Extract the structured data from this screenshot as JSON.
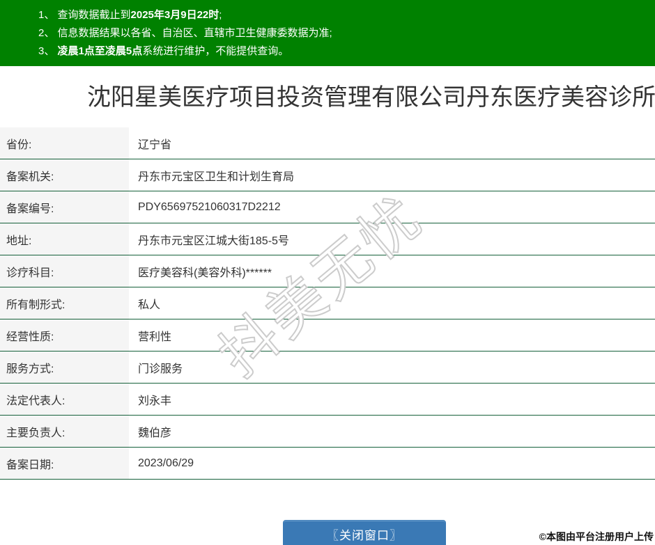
{
  "notice": {
    "items": [
      {
        "pre": "1、 查询数据截止到",
        "bold": "2025年3月9日22时",
        "post": ";"
      },
      {
        "pre": "2、 信息数据结果以各省、自治区、直辖市卫生健康委数据为准;",
        "bold": "",
        "post": ""
      },
      {
        "pre": "3、 ",
        "bold": "凌晨1点至凌晨5点",
        "post": "系统进行维护，不能提供查询。"
      }
    ]
  },
  "title": "沈阳星美医疗项目投资管理有限公司丹东医疗美容诊所",
  "table": {
    "rows": [
      {
        "label": "省份:",
        "value": "辽宁省"
      },
      {
        "label": "备案机关:",
        "value": "丹东市元宝区卫生和计划生育局"
      },
      {
        "label": "备案编号:",
        "value": "PDY65697521060317D2212"
      },
      {
        "label": "地址:",
        "value": "丹东市元宝区江城大街185-5号"
      },
      {
        "label": "诊疗科目:",
        "value": "医疗美容科(美容外科)******"
      },
      {
        "label": "所有制形式:",
        "value": "私人"
      },
      {
        "label": "经营性质:",
        "value": "营利性"
      },
      {
        "label": "服务方式:",
        "value": "门诊服务"
      },
      {
        "label": "法定代表人:",
        "value": "刘永丰"
      },
      {
        "label": "主要负责人:",
        "value": "魏伯彦"
      },
      {
        "label": "备案日期:",
        "value": "2023/06/29"
      }
    ]
  },
  "watermarks": {
    "diagonal": "抖美无忧",
    "credit": "©本图由平台注册用户上传"
  },
  "footer": {
    "close_button_label": "〖关闭窗口〗"
  },
  "colors": {
    "banner_green": "#008100",
    "divider_green": "#15603a",
    "label_bg": "#f5f5f5",
    "button_blue": "#3a79b5",
    "text": "#333333"
  }
}
